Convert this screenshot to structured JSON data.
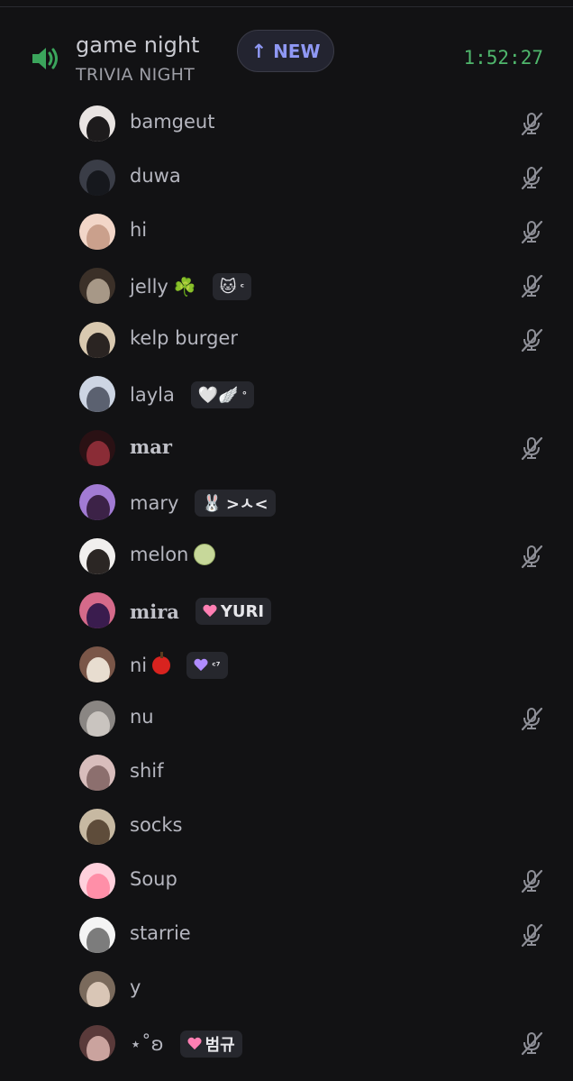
{
  "channel": {
    "name": "game night",
    "status": "TRIVIA NIGHT",
    "new_label": "NEW",
    "new_arrow": "↑",
    "timer": "1:52:27",
    "speaker_icon": "speaker-icon"
  },
  "members": [
    {
      "name": "bamgeut",
      "muted": true,
      "avatar": [
        "#e9e4e2",
        "#1d1b1c"
      ]
    },
    {
      "name": "duwa",
      "muted": true,
      "avatar": [
        "#3a3d47",
        "#16181d"
      ]
    },
    {
      "name": "hi",
      "muted": true,
      "avatar": [
        "#f2d6c8",
        "#caa08c"
      ]
    },
    {
      "name": "jelly",
      "emoji": "☘️",
      "tag": "🐱",
      "tag_sup": "ᶜ",
      "muted": true,
      "avatar": [
        "#3b3028",
        "#a79887"
      ]
    },
    {
      "name": "kelp burger",
      "muted": true,
      "avatar": [
        "#d9c9b0",
        "#2a2422"
      ]
    },
    {
      "name": "layla",
      "tag": "🤍🪽",
      "tag_sup": "°",
      "muted": false,
      "avatar": [
        "#cdd5e3",
        "#5b6170"
      ]
    },
    {
      "name": "mar",
      "muted": true,
      "avatar": [
        "#2a1114",
        "#8a2c36"
      ]
    },
    {
      "name": "mary",
      "tag": "🐰",
      "tag_text": ">ㅅ<",
      "muted": false,
      "avatar": [
        "#a27bd4",
        "#3c2247"
      ]
    },
    {
      "name": "melon",
      "emoji": "melon",
      "muted": true,
      "avatar": [
        "#f1efee",
        "#2b2624"
      ]
    },
    {
      "name": "mira",
      "tag_text": "YURI",
      "tag_heart": "pink",
      "muted": false,
      "avatar": [
        "#d56a8a",
        "#3a1c4e"
      ]
    },
    {
      "name": "ni",
      "emoji": "apple",
      "tag_heart": "purple",
      "tag_sup": "ᶜ⁷",
      "muted": false,
      "avatar": [
        "#7a5648",
        "#e8ddd0"
      ]
    },
    {
      "name": "nu",
      "muted": true,
      "avatar": [
        "#8a8683",
        "#c9c4bf"
      ]
    },
    {
      "name": "shif",
      "muted": false,
      "avatar": [
        "#d8bdbc",
        "#8c6f6e"
      ]
    },
    {
      "name": "socks",
      "muted": false,
      "avatar": [
        "#c7b9a2",
        "#5e4c3a"
      ]
    },
    {
      "name": "Soup",
      "muted": true,
      "avatar": [
        "#ffd0dc",
        "#ff8fa8"
      ]
    },
    {
      "name": "starrie",
      "muted": true,
      "avatar": [
        "#f4f4f4",
        "#7c7c7c"
      ]
    },
    {
      "name": "y",
      "muted": false,
      "avatar": [
        "#7a6a5c",
        "#d9c6b6"
      ]
    },
    {
      "name": "⋆˚ʚ",
      "tag_text": "범규",
      "tag_heart": "pink",
      "muted": true,
      "avatar": [
        "#5a3a3a",
        "#caa39e"
      ]
    }
  ],
  "icons": {
    "mute": "microphone-muted-icon"
  },
  "colors": {
    "background": "#121214",
    "timer": "#4fb66c",
    "new_pill_text": "#8f98f4",
    "speaker": "#3ba55c"
  }
}
